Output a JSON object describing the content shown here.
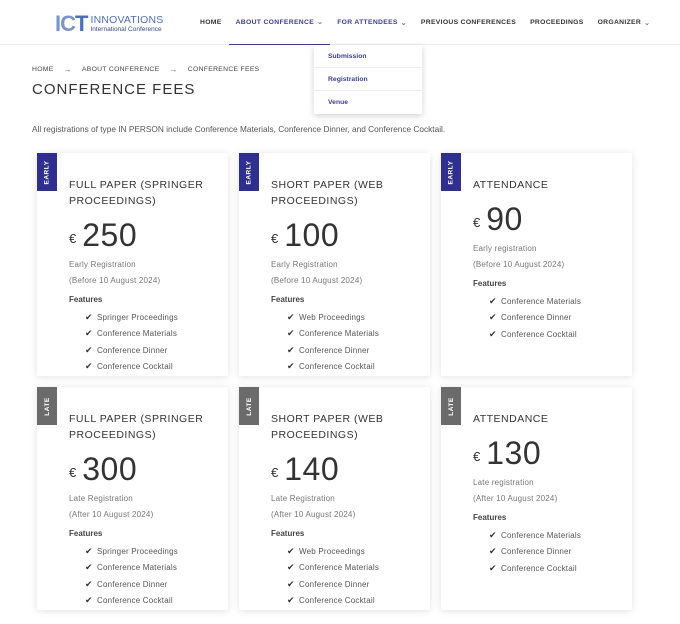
{
  "logo": {
    "mark_a": "IC",
    "mark_b": "T",
    "line1": "INNOVATIONS",
    "line2": "International Conference"
  },
  "nav": [
    {
      "label": "HOME",
      "chevron": false
    },
    {
      "label": "ABOUT CONFERENCE",
      "chevron": true
    },
    {
      "label": "FOR ATTENDEES",
      "chevron": true
    },
    {
      "label": "PREVIOUS CONFERENCES",
      "chevron": false
    },
    {
      "label": "PROCEEDINGS",
      "chevron": false
    },
    {
      "label": "ORGANIZER",
      "chevron": true
    }
  ],
  "dropdown": [
    "Submission",
    "Registration",
    "Venue"
  ],
  "breadcrumb": [
    "HOME",
    "ABOUT CONFERENCE",
    "CONFERENCE FEES"
  ],
  "title": "CONFERENCE FEES",
  "intro": "All registrations of type IN PERSON include Conference Materials, Conference Dinner, and Conference Cocktail.",
  "cards": [
    {
      "ribbon": "EARLY",
      "title": "FULL PAPER (SPRINGER PROCEEDINGS)",
      "currency": "€",
      "price": "250",
      "reg1": "Early Registration",
      "reg2": "(Before 10 August 2024)",
      "features_label": "Features",
      "features": [
        "Springer Proceedings",
        "Conference Materials",
        "Conference Dinner",
        "Conference Cocktail"
      ]
    },
    {
      "ribbon": "EARLY",
      "title": "SHORT PAPER (WEB PROCEEDINGS)",
      "currency": "€",
      "price": "100",
      "reg1": "Early Registration",
      "reg2": "(Before 10 August 2024)",
      "features_label": "Features",
      "features": [
        "Web Proceedings",
        "Conference Materials",
        "Conference Dinner",
        "Conference Cocktail"
      ]
    },
    {
      "ribbon": "EARLY",
      "title": "ATTENDANCE",
      "currency": "€",
      "price": "90",
      "reg1": "Early registration",
      "reg2": "(Before 10 August 2024)",
      "features_label": "Features",
      "features": [
        "Conference Materials",
        "Conference Dinner",
        "Conference Cocktail"
      ]
    },
    {
      "ribbon": "LATE",
      "title": "FULL PAPER (SPRINGER PROCEEDINGS)",
      "currency": "€",
      "price": "300",
      "reg1": "Late Registration",
      "reg2": "(After 10 August 2024)",
      "features_label": "Features",
      "features": [
        "Springer Proceedings",
        "Conference Materials",
        "Conference Dinner",
        "Conference Cocktail"
      ]
    },
    {
      "ribbon": "LATE",
      "title": "SHORT PAPER (WEB PROCEEDINGS)",
      "currency": "€",
      "price": "140",
      "reg1": "Late Registration",
      "reg2": "(After 10 August 2024)",
      "features_label": "Features",
      "features": [
        "Web Proceedings",
        "Conference Materials",
        "Conference Dinner",
        "Conference Cocktail"
      ]
    },
    {
      "ribbon": "LATE",
      "title": "ATTENDANCE",
      "currency": "€",
      "price": "130",
      "reg1": "Late registration",
      "reg2": "(After 10 August 2024)",
      "features_label": "Features",
      "features": [
        "Conference Materials",
        "Conference Dinner",
        "Conference Cocktail"
      ]
    }
  ],
  "colors": {
    "early_ribbon": "#2f2f8f",
    "late_ribbon": "#6b6b6b",
    "accent": "#3b3f8f"
  }
}
